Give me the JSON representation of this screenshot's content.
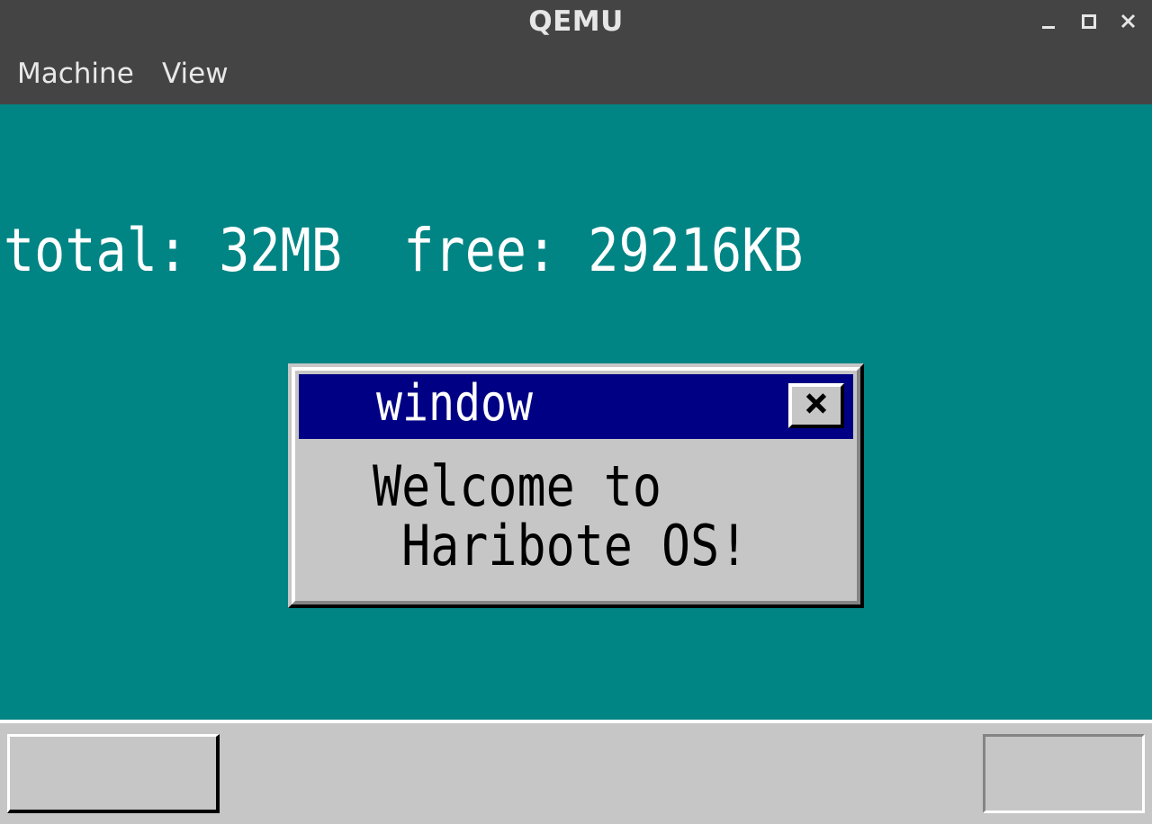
{
  "host": {
    "window_title": "QEMU",
    "menu": [
      {
        "label": "Machine"
      },
      {
        "label": "View"
      }
    ],
    "controls": [
      "minimize-icon",
      "maximize-icon",
      "close-icon"
    ]
  },
  "guest": {
    "desktop_color": "#008484",
    "memory_info": "total: 32MB  free: 29216KB",
    "window": {
      "title": "window",
      "close_glyph": "×",
      "message_line1": "Welcome to",
      "message_line2": " Haribote OS!"
    },
    "taskbar": {
      "start_label": "",
      "tray_label": ""
    }
  },
  "colors": {
    "host_chrome": "#444444",
    "guest_desktop": "#008484",
    "window_title_bg": "#000084",
    "window_face": "#c6c6c6"
  }
}
